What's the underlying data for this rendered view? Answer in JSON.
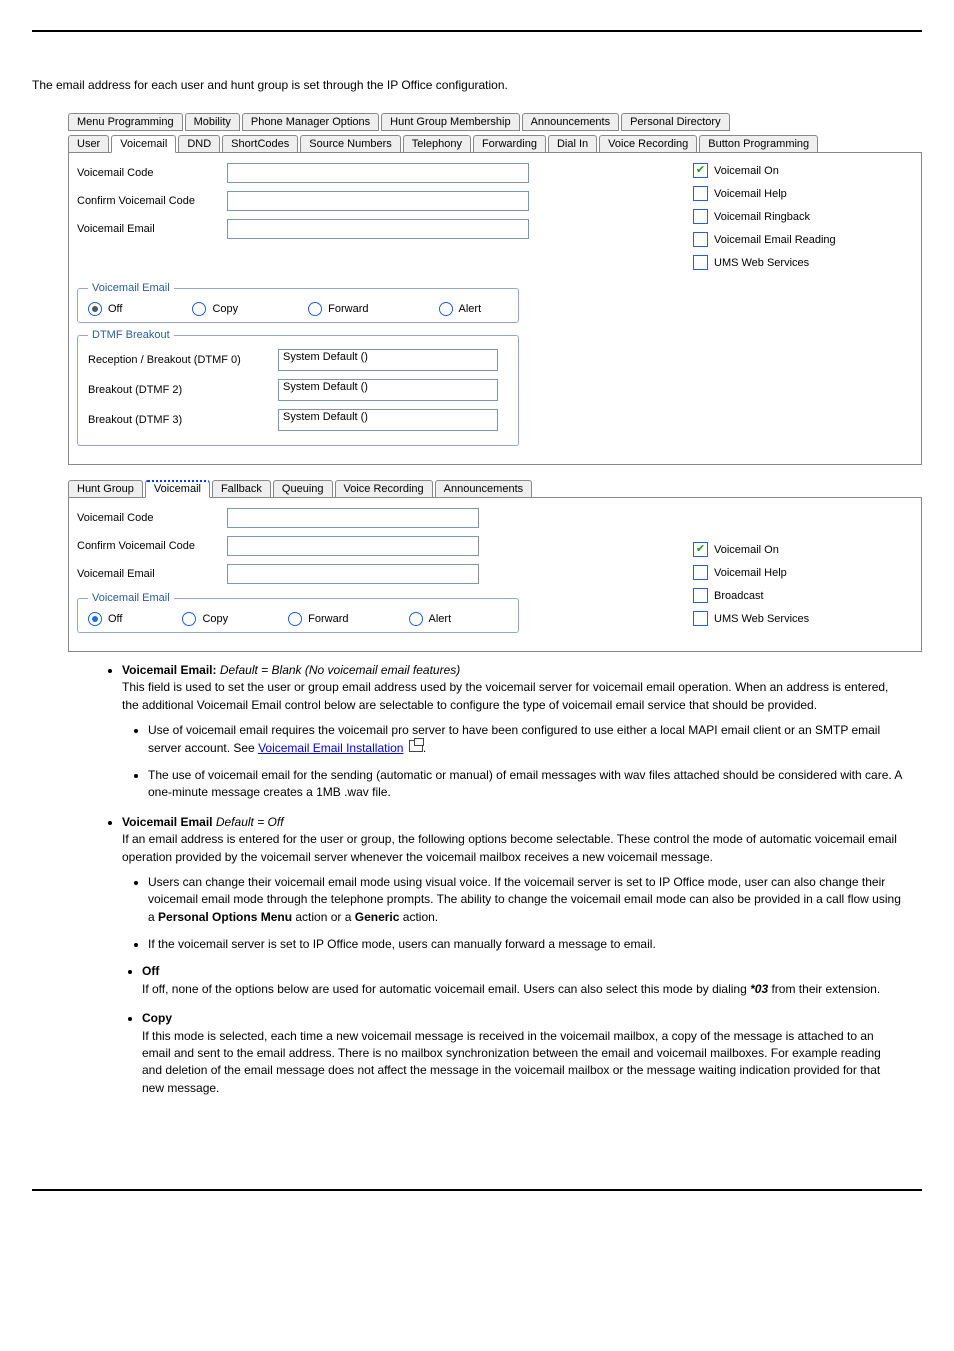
{
  "intro": "The email address for each user and hunt group is set through the IP Office configuration.",
  "userTabsTop": [
    "Menu Programming",
    "Mobility",
    "Phone Manager Options",
    "Hunt Group Membership",
    "Announcements",
    "Personal Directory"
  ],
  "userTabsBottom": [
    "User",
    "Voicemail",
    "DND",
    "ShortCodes",
    "Source Numbers",
    "Telephony",
    "Forwarding",
    "Dial In",
    "Voice Recording",
    "Button Programming"
  ],
  "userTabsBottomActive": "Voicemail",
  "user": {
    "voicemailCodeLabel": "Voicemail Code",
    "confirmVoicemailCodeLabel": "Confirm Voicemail Code",
    "voicemailEmailLabel": "Voicemail Email",
    "checks": [
      {
        "label": "Voicemail On",
        "checked": true
      },
      {
        "label": "Voicemail Help",
        "checked": false
      },
      {
        "label": "Voicemail Ringback",
        "checked": false
      },
      {
        "label": "Voicemail Email Reading",
        "checked": false
      },
      {
        "label": "UMS Web Services",
        "checked": false
      }
    ],
    "emailGroupTitle": "Voicemail Email",
    "emailRadios": [
      "Off",
      "Copy",
      "Forward",
      "Alert"
    ],
    "emailRadioSelected": "Off",
    "dtmfTitle": "DTMF Breakout",
    "dtmf": [
      {
        "label": "Reception / Breakout (DTMF 0)",
        "value": "System Default ()"
      },
      {
        "label": "Breakout (DTMF 2)",
        "value": "System Default ()"
      },
      {
        "label": "Breakout (DTMF 3)",
        "value": "System Default ()"
      }
    ]
  },
  "hgTabs": [
    "Hunt Group",
    "Voicemail",
    "Fallback",
    "Queuing",
    "Voice Recording",
    "Announcements"
  ],
  "hgTabsActive": "Voicemail",
  "hg": {
    "voicemailCodeLabel": "Voicemail Code",
    "confirmVoicemailCodeLabel": "Confirm Voicemail Code",
    "voicemailEmailLabel": "Voicemail Email",
    "checks": [
      {
        "label": "Voicemail On",
        "checked": true
      },
      {
        "label": "Voicemail Help",
        "checked": false
      },
      {
        "label": "Broadcast",
        "checked": false
      },
      {
        "label": "UMS Web Services",
        "checked": false
      }
    ],
    "emailGroupTitle": "Voicemail Email",
    "emailRadios": [
      "Off",
      "Copy",
      "Forward",
      "Alert"
    ],
    "emailRadioSelected": "Off"
  },
  "doc": {
    "veTitle": "Voicemail Email:",
    "veDefault": "Default = Blank (No voicemail email features)",
    "vePara": "This field is used to set the user or group email address used by the voicemail server for voicemail email operation. When an address is entered, the additional Voicemail Email control below are selectable to configure the type of voicemail email service that should be provided.",
    "veSub1a": "Use of voicemail email requires the voicemail pro server to have been configured to use either a local MAPI email client or an SMTP email server account. See ",
    "veSub1Link": "Voicemail Email Installation",
    "veSub1b": ".",
    "veSub2": "The use of voicemail email for the sending (automatic or manual) of email messages with wav files attached should be considered with care. A one-minute message creates a 1MB .wav file.",
    "ve2Title": "Voicemail Email",
    "ve2Default": "Default = Off",
    "ve2Para": "If an email address is entered for the user or group, the following options become selectable. These control the mode of automatic voicemail email operation provided by the voicemail server whenever the voicemail mailbox receives a new voicemail message.",
    "ve2Sub1a": "Users can change their voicemail email mode using visual voice. If the voicemail server is set to IP Office mode, user can also change their voicemail email mode through the telephone prompts. The ability to change the voicemail email mode can also be provided in a call flow using a ",
    "ve2Sub1b": "Personal Options Menu",
    "ve2Sub1c": " action or a ",
    "ve2Sub1d": "Generic",
    "ve2Sub1e": " action.",
    "ve2Sub2": "If the voicemail server is set to IP Office mode, users can manually forward a message to email.",
    "offTitle": "Off",
    "offBody1": "If off, none of the options below are used for automatic voicemail email. Users can also select this mode by dialing ",
    "offCode": "*03",
    "offBody2": " from their extension.",
    "copyTitle": "Copy",
    "copyBody": "If this mode is selected, each time a new voicemail message is received in the voicemail mailbox, a copy of the message is attached to an email and sent to the email address. There is no mailbox synchronization between the email and voicemail mailboxes. For example reading and deletion of the email message does not affect the message in the voicemail mailbox or the message waiting indication provided for that new message."
  }
}
